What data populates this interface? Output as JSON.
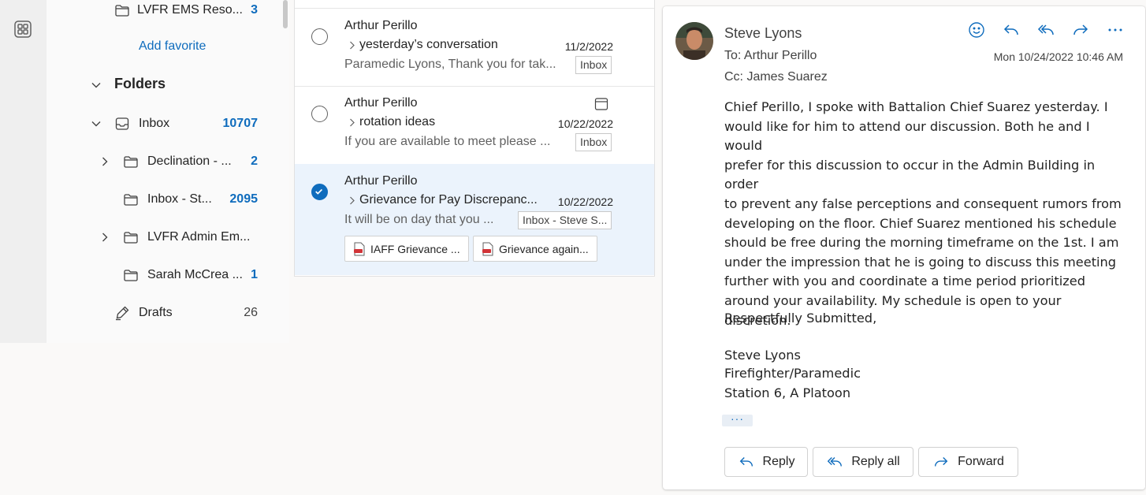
{
  "favorites": {
    "item": {
      "label": "LVFR EMS Reso...",
      "count": "3"
    },
    "add_favorite": "Add favorite"
  },
  "folders": {
    "header": "Folders",
    "inbox": {
      "label": "Inbox",
      "count": "10707"
    },
    "subfolders": [
      {
        "label": "Declination - ...",
        "count": "2"
      },
      {
        "label": "Inbox - St...",
        "count": "2095"
      },
      {
        "label": "LVFR Admin Em...",
        "count": ""
      },
      {
        "label": "Sarah McCrea ...",
        "count": "1"
      }
    ],
    "drafts": {
      "label": "Drafts",
      "count": "26"
    }
  },
  "messages": [
    {
      "sender": "Arthur Perillo",
      "subject": "yesterday’s conversation",
      "date": "11/2/2022",
      "preview": "Paramedic Lyons, Thank you for tak...",
      "tag": "Inbox",
      "selected": false
    },
    {
      "sender": "Arthur Perillo",
      "subject": "rotation ideas",
      "date": "10/22/2022",
      "preview": "If you are available to meet please ...",
      "tag": "Inbox",
      "selected": false
    },
    {
      "sender": "Arthur Perillo",
      "subject": "Grievance for Pay Discrepanc...",
      "date": "10/22/2022",
      "preview": "It will be on day that you ...",
      "tag": "Inbox - Steve S...",
      "selected": true,
      "attachments": [
        "IAFF Grievance ...",
        "Grievance again..."
      ]
    }
  ],
  "reading": {
    "from": "Steve Lyons",
    "to": "To:  Arthur Perillo",
    "cc": "Cc:  James Suarez",
    "date": "Mon 10/24/2022 10:46 AM",
    "body": "Chief Perillo, I spoke with Battalion Chief Suarez yesterday.  I\nwould like for him to attend our discussion. Both he and I would\nprefer for this discussion to occur in the Admin Building in order\nto prevent any false perceptions and consequent rumors from\ndeveloping on the floor.  Chief Suarez mentioned his schedule\nshould be free during the morning timeframe on the 1st.  I am\nunder the impression that he is going to discuss this meeting\nfurther with you and coordinate a time period prioritized\naround your availability.  My schedule is open to your\ndiscretion.",
    "closing": "Respectfully Submitted,",
    "signature": [
      "Steve Lyons",
      "Firefighter/Paramedic",
      "Station 6, A Platoon"
    ],
    "more": "···",
    "buttons": {
      "reply": "Reply",
      "reply_all": "Reply all",
      "forward": "Forward"
    }
  },
  "colors": {
    "accent": "#0f6cbd",
    "selected_bg": "#ebf3fc"
  }
}
